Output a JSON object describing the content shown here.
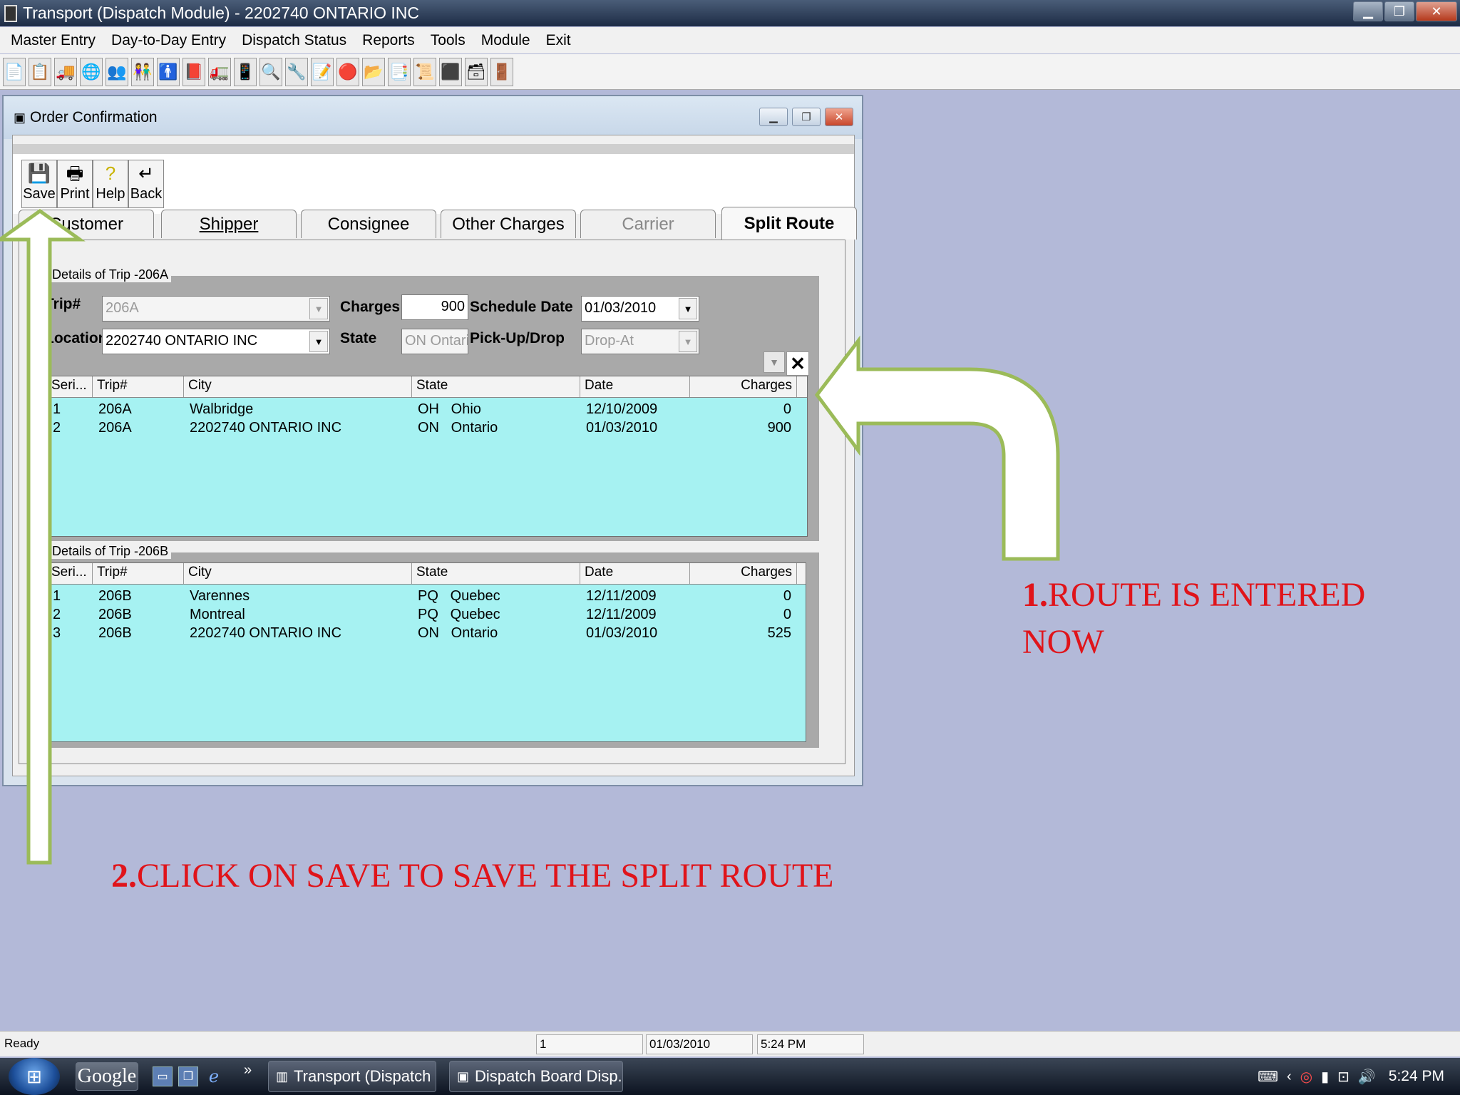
{
  "window": {
    "title": "Transport (Dispatch Module) - 2202740 ONTARIO INC",
    "min": "▁",
    "max": "❐",
    "close": "✕"
  },
  "menu": [
    "Master Entry",
    "Day-to-Day Entry",
    "Dispatch Status",
    "Reports",
    "Tools",
    "Module",
    "Exit"
  ],
  "toolbar_icons": [
    "📄",
    "📋",
    "🚚",
    "🌐",
    "👥",
    "👫",
    "🚹",
    "📕",
    "🚛",
    "📱",
    "🔍",
    "🔧",
    "📝",
    "🔴",
    "📂",
    "📑",
    "📜",
    "⬛",
    "🗃",
    "🚪"
  ],
  "order_window": {
    "title": "Order Confirmation",
    "buttons": {
      "save": "Save",
      "print": "Print",
      "help": "Help",
      "back": "Back"
    },
    "tabs": [
      "Customer",
      "Shipper",
      "Consignee",
      "Other Charges",
      "Carrier",
      "Split Route"
    ],
    "group_a": {
      "label": "Details of Trip -206A",
      "trip_label": "Trip#",
      "trip_value": "206A",
      "charges_label": "Charges",
      "charges_value": "900",
      "schedule_label": "Schedule Date",
      "schedule_value": "01/03/2010",
      "location_label": "Location",
      "location_value": "2202740 ONTARIO INC",
      "state_label": "State",
      "state_value": "ON  Ontario",
      "pickup_label": "Pick-Up/Drop",
      "pickup_value": "Drop-At",
      "delete_glyph": "✕",
      "columns": [
        "Seri...",
        "Trip#",
        "City",
        "State",
        "Date",
        "Charges"
      ],
      "rows": [
        [
          "1",
          "206A",
          "Walbridge",
          "OH   Ohio",
          "12/10/2009",
          "0"
        ],
        [
          "2",
          "206A",
          "2202740 ONTARIO INC",
          "ON   Ontario",
          "01/03/2010",
          "900"
        ]
      ]
    },
    "group_b": {
      "label": "Details of Trip -206B",
      "columns": [
        "Seri...",
        "Trip#",
        "City",
        "State",
        "Date",
        "Charges"
      ],
      "rows": [
        [
          "1",
          "206B",
          "Varennes",
          "PQ   Quebec",
          "12/11/2009",
          "0"
        ],
        [
          "2",
          "206B",
          "Montreal",
          "PQ   Quebec",
          "12/11/2009",
          "0"
        ],
        [
          "3",
          "206B",
          "2202740 ONTARIO INC",
          "ON   Ontario",
          "01/03/2010",
          "525"
        ]
      ]
    }
  },
  "annotations": {
    "one_num": "1.",
    "one_line1": "ROUTE IS ENTERED",
    "one_line2": "NOW",
    "two_num": "2.",
    "two_text": "CLICK ON SAVE TO SAVE THE SPLIT ROUTE",
    "arrow_fill": "#ffffff",
    "arrow_stroke": "#9bbb59"
  },
  "status": {
    "ready": "Ready",
    "page": "1",
    "date": "01/03/2010",
    "time": "5:24 PM"
  },
  "taskbar": {
    "google": "Google",
    "chevron": "»",
    "task1": "Transport (Dispatch ...",
    "task2": "Dispatch Board Disp...",
    "clock": "5:24 PM"
  }
}
